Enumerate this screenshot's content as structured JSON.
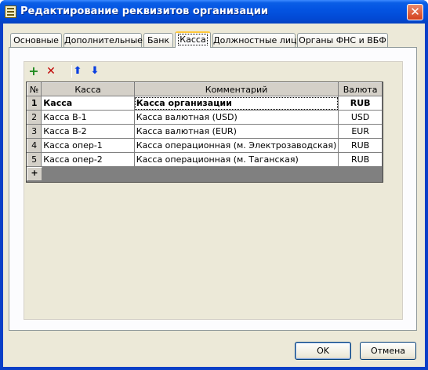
{
  "window": {
    "title": "Редактирование реквизитов организации",
    "close_label": "✕"
  },
  "tabs": [
    {
      "label": "Основные",
      "active": false
    },
    {
      "label": "Дополнительные",
      "active": false
    },
    {
      "label": "Банк",
      "active": false
    },
    {
      "label": "Касса",
      "active": true
    },
    {
      "label": "Должностные лица",
      "active": false
    },
    {
      "label": "Органы ФНС и ВБФ",
      "active": false
    }
  ],
  "toolbar": {
    "add_icon": "+",
    "delete_icon": "✕",
    "up_icon": "⬆",
    "down_icon": "⬇",
    "add_color": "#1f8a1f",
    "delete_color": "#c00000",
    "arrow_color": "#0a3fe0"
  },
  "grid": {
    "columns": [
      "№",
      "Касса",
      "Комментарий",
      "Валюта"
    ],
    "rows": [
      {
        "num": "1",
        "kassa": "Касса",
        "comment": "Касса организации",
        "currency": "RUB",
        "bold": true
      },
      {
        "num": "2",
        "kassa": "Касса В-1",
        "comment": "Касса валютная (USD)",
        "currency": "USD",
        "bold": false
      },
      {
        "num": "3",
        "kassa": "Касса В-2",
        "comment": "Касса валютная (EUR)",
        "currency": "EUR",
        "bold": false
      },
      {
        "num": "4",
        "kassa": "Касса опер-1",
        "comment": "Касса операционная (м. Электрозаводская)",
        "currency": "RUB",
        "bold": false
      },
      {
        "num": "5",
        "kassa": "Касса опер-2",
        "comment": "Касса операционная (м. Таганская)",
        "currency": "RUB",
        "bold": false
      }
    ],
    "new_row_marker": "+"
  },
  "buttons": {
    "ok": "OK",
    "cancel": "Отмена"
  }
}
